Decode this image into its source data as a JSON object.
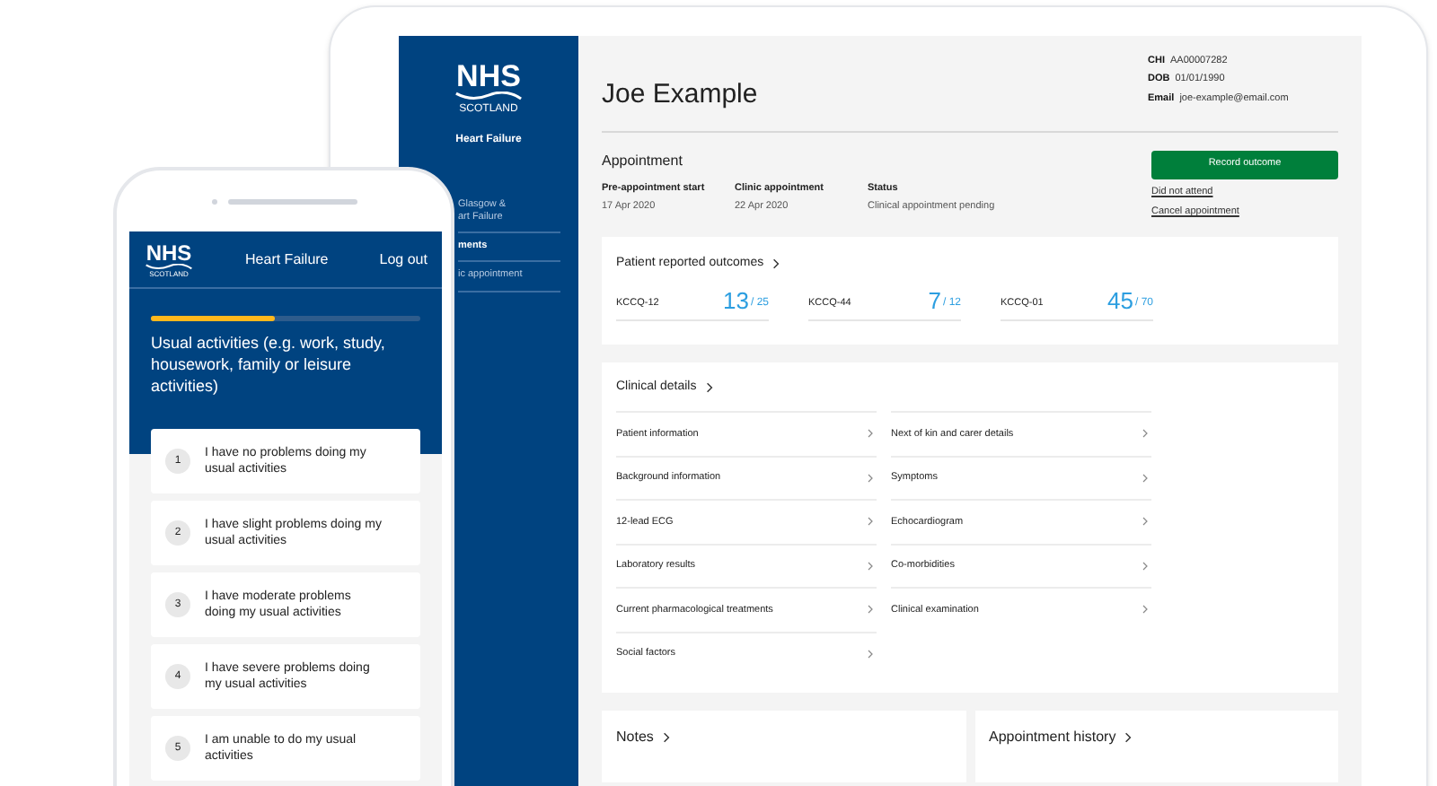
{
  "tablet": {
    "logo": {
      "word": "NHS",
      "region": "SCOTLAND"
    },
    "service": "Heart Failure",
    "sidebar_items": [
      {
        "lines": [
          "Glasgow &",
          "art Failure"
        ],
        "selected": false
      },
      {
        "lines": [
          "ments"
        ],
        "selected": true
      },
      {
        "lines": [
          "ic appointment"
        ],
        "selected": false
      }
    ],
    "patient": {
      "name": "Joe Example",
      "details": [
        {
          "label": "CHI",
          "value": "AA00007282"
        },
        {
          "label": "DOB",
          "value": "01/01/1990"
        },
        {
          "label": "Email",
          "value": "joe-example@email.com"
        }
      ]
    },
    "appointment": {
      "title": "Appointment",
      "fields": [
        {
          "label": "Pre-appointment start",
          "value": "17 Apr 2020"
        },
        {
          "label": "Clinic appointment",
          "value": "22 Apr 2020"
        },
        {
          "label": "Status",
          "value": "Clinical appointment pending"
        }
      ],
      "primary_button": "Record outcome",
      "links": [
        "Did not attend",
        "Cancel appointment"
      ]
    },
    "outcomes": {
      "title": "Patient reported outcomes",
      "scores": [
        {
          "name": "KCCQ-12",
          "score": "13",
          "total": "/ 25"
        },
        {
          "name": "KCCQ-44",
          "score": "7",
          "total": "/ 12"
        },
        {
          "name": "KCCQ-01",
          "score": "45",
          "total": "/ 70"
        }
      ]
    },
    "clinical_details": {
      "title": "Clinical details",
      "items": [
        "Patient information",
        "Next of kin and carer details",
        "Background information",
        "Symptoms",
        "12-lead ECG",
        "Echocardiogram",
        "Laboratory results",
        "Co-morbidities",
        "Current pharmacological treatments",
        "Clinical examination",
        "Social factors"
      ]
    },
    "bottom_cards": [
      "Notes",
      "Appointment history"
    ]
  },
  "phone": {
    "logo": {
      "word": "NHS",
      "region": "SCOTLAND"
    },
    "title": "Heart Failure",
    "logout": "Log out",
    "progress": {
      "level": 0.46
    },
    "question": "Usual activities (e.g. work, study, housework, family or leisure activities)",
    "answers": [
      {
        "number": "1",
        "text": "I have no problems doing my usual activities"
      },
      {
        "number": "2",
        "text": "I have slight problems doing my usual activities"
      },
      {
        "number": "3",
        "text": "I have moderate problems doing my usual activities"
      },
      {
        "number": "4",
        "text": "I have severe problems doing my usual activities"
      },
      {
        "number": "5",
        "text": "I am unable to do my usual activities"
      }
    ]
  }
}
